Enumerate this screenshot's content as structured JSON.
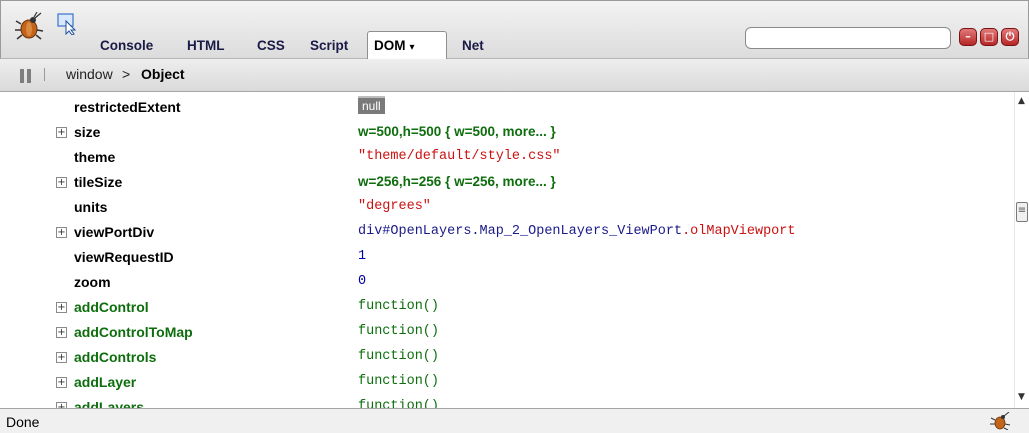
{
  "toolbar": {
    "tabs": [
      {
        "label": "Console"
      },
      {
        "label": "HTML"
      },
      {
        "label": "CSS"
      },
      {
        "label": "Script"
      },
      {
        "label": "DOM",
        "active": true,
        "caret": "▾"
      },
      {
        "label": "Net"
      }
    ],
    "search": {
      "value": "",
      "placeholder": ""
    },
    "window_buttons": {
      "minimize": "–",
      "detach": "□",
      "close": "⏻"
    }
  },
  "breadcrumb": {
    "items": [
      "window",
      "Object"
    ],
    "separator": ">"
  },
  "dom": {
    "rows": [
      {
        "name": "restrictedExtent",
        "value": "null",
        "kind": "null",
        "expandable": false
      },
      {
        "name": "size",
        "value": "w=500,h=500 { w=500,  more... }",
        "kind": "object",
        "expandable": true
      },
      {
        "name": "theme",
        "value": "\"theme/default/style.css\"",
        "kind": "string",
        "expandable": false
      },
      {
        "name": "tileSize",
        "value": "w=256,h=256 { w=256,  more... }",
        "kind": "object",
        "expandable": true
      },
      {
        "name": "units",
        "value": "\"degrees\"",
        "kind": "string",
        "expandable": false
      },
      {
        "name": "viewPortDiv",
        "value_element": "div#OpenLayers.Map_2_OpenLayers_ViewPort",
        "value_class": ".olMapViewport",
        "kind": "element",
        "expandable": true
      },
      {
        "name": "viewRequestID",
        "value": "1",
        "kind": "number",
        "expandable": false
      },
      {
        "name": "zoom",
        "value": "0",
        "kind": "number",
        "expandable": false
      },
      {
        "name": "addControl",
        "value": "function()",
        "kind": "function",
        "expandable": true
      },
      {
        "name": "addControlToMap",
        "value": "function()",
        "kind": "function",
        "expandable": true
      },
      {
        "name": "addControls",
        "value": "function()",
        "kind": "function",
        "expandable": true
      },
      {
        "name": "addLayer",
        "value": "function()",
        "kind": "function",
        "expandable": true
      },
      {
        "name": "addLayers",
        "value": "function()",
        "kind": "function",
        "expandable": true
      }
    ]
  },
  "status": {
    "text": "Done"
  },
  "colors": {
    "prop_green": "#0e6e0e",
    "string_red": "#cc1111",
    "element_navy": "#1a1a8a",
    "number_blue": "#0000aa",
    "button_red": "#b72626"
  },
  "icons": [
    "firebug-icon",
    "inspect-icon",
    "pause-icon",
    "expand-plus-icon",
    "scroll-up-icon",
    "scroll-down-icon",
    "firebug-status-icon"
  ]
}
